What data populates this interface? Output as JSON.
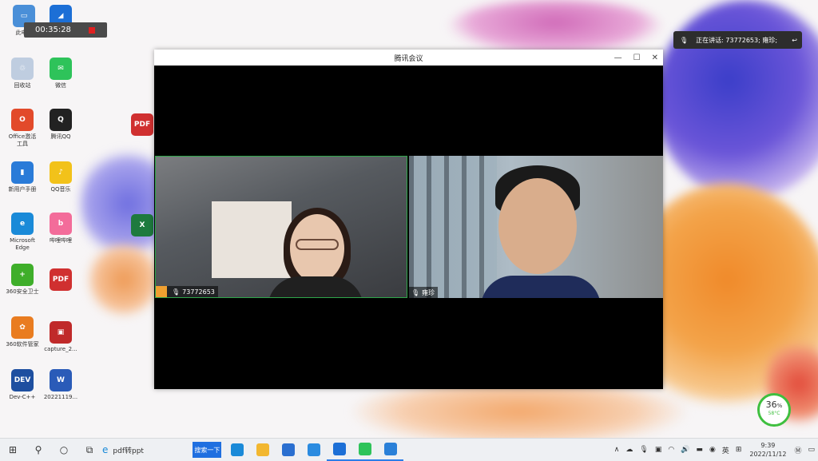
{
  "desktop_icons": [
    {
      "label": "此电脑",
      "color": "#4a8fd8",
      "glyph": "▭"
    },
    {
      "label": "",
      "color": "#1c6fd6",
      "glyph": "◢"
    },
    {
      "label": "回收站",
      "color": "#bfcde0",
      "glyph": "♲"
    },
    {
      "label": "微信",
      "color": "#2ec35a",
      "glyph": "✉"
    },
    {
      "label": "Office激活\n工具",
      "color": "#e24a2a",
      "glyph": "O"
    },
    {
      "label": "腾讯QQ",
      "color": "#222222",
      "glyph": "Q"
    },
    {
      "label": "",
      "color": "#d03030",
      "glyph": "PDF"
    },
    {
      "label": "新用户手册",
      "color": "#2a7bd8",
      "glyph": "▮"
    },
    {
      "label": "QQ音乐",
      "color": "#f2c21a",
      "glyph": "♪"
    },
    {
      "label": "Microsoft\nEdge",
      "color": "#1a8ad8",
      "glyph": "e"
    },
    {
      "label": "哔哩哔哩",
      "color": "#f36c9a",
      "glyph": "b"
    },
    {
      "label": "",
      "color": "#1e7a3e",
      "glyph": "X"
    },
    {
      "label": "360安全卫士",
      "color": "#3fae2a",
      "glyph": "+"
    },
    {
      "label": "",
      "color": "#d03030",
      "glyph": "PDF"
    },
    {
      "label": "360软件管家",
      "color": "#e97c20",
      "glyph": "✿"
    },
    {
      "label": "capture_2...",
      "color": "#c02a2a",
      "glyph": "▣"
    },
    {
      "label": "Dev-C++",
      "color": "#1e4fa0",
      "glyph": "DEV"
    },
    {
      "label": "20221119...",
      "color": "#2a5bb8",
      "glyph": "W"
    }
  ],
  "recording": {
    "time": "00:35:28"
  },
  "speaking": {
    "text": "正在讲话: 73772653; 雍珍;"
  },
  "window": {
    "title": "腾讯会议",
    "minimize": "—",
    "maximize": "☐",
    "close": "✕"
  },
  "participants": [
    {
      "name": "73772653"
    },
    {
      "name": "雍珍"
    }
  ],
  "battery": {
    "percent": "36",
    "percent_sign": "%",
    "temp": "58°C"
  },
  "taskbar": {
    "start_icon": "⊞",
    "search_icon": "⚲",
    "cortana_icon": "○",
    "taskview_icon": "⧉",
    "search_text": "pdf转ppt",
    "search_button": "搜索一下",
    "apps": [
      {
        "name": "edge",
        "color": "#1a8ad8"
      },
      {
        "name": "explorer",
        "color": "#f2b730"
      },
      {
        "name": "mail",
        "color": "#2a6fd0"
      },
      {
        "name": "store",
        "color": "#2a8be0"
      },
      {
        "name": "tencent-meeting",
        "color": "#1c6fd6"
      },
      {
        "name": "wechat",
        "color": "#2ec35a"
      },
      {
        "name": "photos",
        "color": "#2a80d8"
      }
    ],
    "tray": {
      "chevron": "∧",
      "lang": "英",
      "time": "9:39",
      "date": "2022/11/12",
      "notify": "▭"
    }
  }
}
